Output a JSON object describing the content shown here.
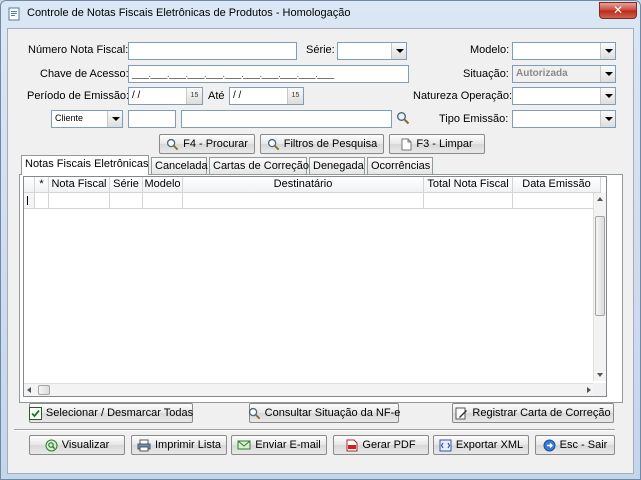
{
  "window": {
    "title": "Controle de Notas Fiscais Eletrônicas de Produtos - Homologação",
    "close_label": "✕"
  },
  "form": {
    "numero_label": "Número Nota Fiscal:",
    "numero_value": "",
    "serie_label": "Série:",
    "serie_value": "",
    "modelo_label": "Modelo:",
    "modelo_value": "",
    "chave_label": "Chave de Acesso:",
    "chave_value": "____.____.____.____.____.____.____.____.____.____.____",
    "situacao_label": "Situação:",
    "situacao_value": "Autorizada",
    "periodo_label": "Período de Emissão:",
    "periodo_inicio": " /  /",
    "ate_label": "Até",
    "periodo_fim": " /  /",
    "natureza_label": "Natureza Operação:",
    "natureza_value": "",
    "tipo_pessoa_value": "Cliente",
    "codigo_value": "",
    "nome_value": "",
    "tipo_emissao_label": "Tipo Emissão:",
    "tipo_emissao_value": ""
  },
  "search_buttons": {
    "procurar": "F4 - Procurar",
    "filtros": "Filtros de Pesquisa",
    "limpar": "F3 - Limpar"
  },
  "tabs": [
    {
      "label": "Notas Fiscais Eletrônicas",
      "active": true
    },
    {
      "label": "Cancelada",
      "active": false
    },
    {
      "label": "Cartas de Correção",
      "active": false
    },
    {
      "label": "Denegada",
      "active": false
    },
    {
      "label": "Ocorrências",
      "active": false
    }
  ],
  "grid": {
    "columns": [
      "*",
      "Nota Fiscal",
      "Série",
      "Modelo",
      "Destinatário",
      "Total Nota Fiscal",
      "Data Emissão"
    ]
  },
  "actions": {
    "selecionar": "Selecionar / Desmarcar Todas",
    "consultar": "Consultar Situação da NF-e",
    "registrar": "Registrar Carta de Correção"
  },
  "bottom": {
    "visualizar": "Visualizar",
    "imprimir": "Imprimir Lista",
    "email": "Enviar E-mail",
    "pdf": "Gerar PDF",
    "xml": "Exportar XML",
    "sair": "Esc - Sair"
  },
  "colors": {
    "title_bg": "#c4d6ea",
    "close_red": "#c7453a",
    "input_border": "#7f9db9"
  }
}
